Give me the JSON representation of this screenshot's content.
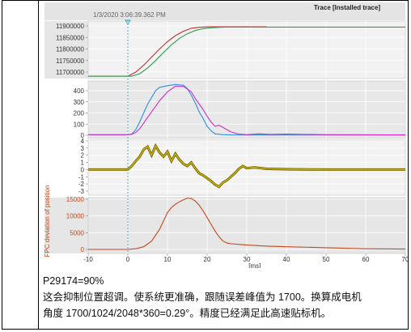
{
  "header": {
    "timestamp": "1/3/2020 3:06:39.362 PM",
    "trace_title": "Trace [Installed trace]"
  },
  "chart_data": [
    {
      "type": "line",
      "ylim": [
        11650000,
        11900000
      ],
      "yticks": [
        "11900000",
        "11850000",
        "11800000",
        "11750000",
        "11700000"
      ],
      "series": [
        {
          "color": "#cc2b2b",
          "x": [
            -10,
            0,
            2,
            4,
            6,
            8,
            10,
            12,
            14,
            16,
            18,
            20,
            22,
            26,
            35
          ],
          "values": [
            11682000,
            11682000,
            11700000,
            11730000,
            11765000,
            11800000,
            11832000,
            11858000,
            11877000,
            11890000,
            11894000,
            11896000,
            11896000,
            11896000,
            11896000
          ]
        },
        {
          "color": "#2f9b4b",
          "x": [
            -10,
            1,
            3,
            5,
            7,
            9,
            11,
            13,
            15,
            17,
            19,
            21,
            23,
            25,
            70
          ],
          "values": [
            11682000,
            11682000,
            11693000,
            11718000,
            11750000,
            11785000,
            11818000,
            11846000,
            11866000,
            11880000,
            11888000,
            11892000,
            11894000,
            11895000,
            11895000
          ]
        }
      ]
    },
    {
      "type": "line",
      "ylim": [
        0,
        450
      ],
      "yticks": [
        "400",
        "300",
        "200",
        "100",
        "0"
      ],
      "series": [
        {
          "color": "#2b8fe0",
          "x": [
            -10,
            0,
            1,
            2,
            3,
            4,
            5,
            6,
            7,
            8,
            10,
            12,
            14,
            15,
            16,
            17,
            18,
            19,
            20,
            21,
            22,
            24,
            26,
            30,
            70
          ],
          "values": [
            3,
            3,
            10,
            50,
            120,
            200,
            280,
            340,
            400,
            430,
            445,
            455,
            450,
            420,
            360,
            290,
            210,
            150,
            80,
            40,
            12,
            5,
            3,
            2,
            2
          ]
        },
        {
          "color": "#d030c8",
          "x": [
            -10,
            0,
            1,
            2,
            3,
            4,
            5,
            6,
            7,
            8,
            9,
            10,
            12,
            14,
            16,
            17,
            18,
            19,
            20,
            21,
            22,
            23,
            24,
            25,
            26,
            27,
            28,
            30,
            33,
            36,
            40,
            50,
            70
          ],
          "values": [
            5,
            5,
            8,
            25,
            60,
            110,
            160,
            210,
            260,
            310,
            350,
            390,
            440,
            440,
            390,
            330,
            280,
            230,
            170,
            120,
            80,
            90,
            70,
            50,
            30,
            20,
            10,
            5,
            12,
            8,
            10,
            5,
            3
          ]
        }
      ]
    },
    {
      "type": "line",
      "ylim": [
        -4,
        4
      ],
      "yticks": [
        "4",
        "3",
        "2",
        "1",
        "0",
        "-1",
        "-2",
        "-3"
      ],
      "series": [
        {
          "color": "#c8b400",
          "x": [
            -10,
            0,
            1,
            2,
            3,
            4,
            5,
            6,
            7,
            8,
            9,
            10,
            11,
            12,
            13,
            14,
            15,
            16,
            17,
            18,
            19,
            20,
            21,
            22,
            23,
            24,
            25,
            26,
            27,
            28,
            29,
            30,
            32,
            35,
            40,
            50,
            70
          ],
          "values": [
            0,
            0,
            0.5,
            1.2,
            1.8,
            2.8,
            3.2,
            2.0,
            3.3,
            2.4,
            1.8,
            2.5,
            1.2,
            2.2,
            1.4,
            0.8,
            0.5,
            1.0,
            0.2,
            -0.5,
            -0.8,
            -1.2,
            -1.6,
            -2.1,
            -2.4,
            -1.8,
            -1.5,
            -1.0,
            -0.5,
            0.1,
            0.5,
            0.2,
            0.3,
            0.1,
            0.05,
            0,
            0
          ]
        }
      ]
    },
    {
      "type": "line",
      "ylabel": "FPC deviation of position",
      "xlabel": "[ms]",
      "ylim": [
        -500,
        16000
      ],
      "yticks": [
        "15000",
        "10000",
        "5000",
        "0"
      ],
      "xticks": [
        "-10",
        "0",
        "10",
        "20",
        "30",
        "40",
        "50",
        "60",
        "70"
      ],
      "series": [
        {
          "color": "#c24a1e",
          "x": [
            -10,
            0,
            2,
            4,
            6,
            8,
            9,
            10,
            11,
            12,
            13,
            14,
            15,
            16,
            17,
            18,
            19,
            20,
            21,
            22,
            23,
            24,
            25,
            26,
            28,
            30,
            35,
            40,
            50,
            60,
            70
          ],
          "values": [
            0,
            0,
            200,
            800,
            2500,
            6000,
            8500,
            11000,
            12500,
            13500,
            14200,
            14800,
            15300,
            15200,
            14500,
            13200,
            11500,
            9500,
            7500,
            5500,
            3800,
            2500,
            1900,
            1700,
            1500,
            1300,
            1000,
            800,
            500,
            200,
            100
          ]
        }
      ]
    }
  ],
  "caption": {
    "line1": "P29174=90%",
    "line2": "这会抑制位置超调。使系统更准确，跟随误差峰值为 1700。换算成电机",
    "line3": "角度 1700/1024/2048*360=0.29°。精度已经满足此高速贴标机。"
  }
}
